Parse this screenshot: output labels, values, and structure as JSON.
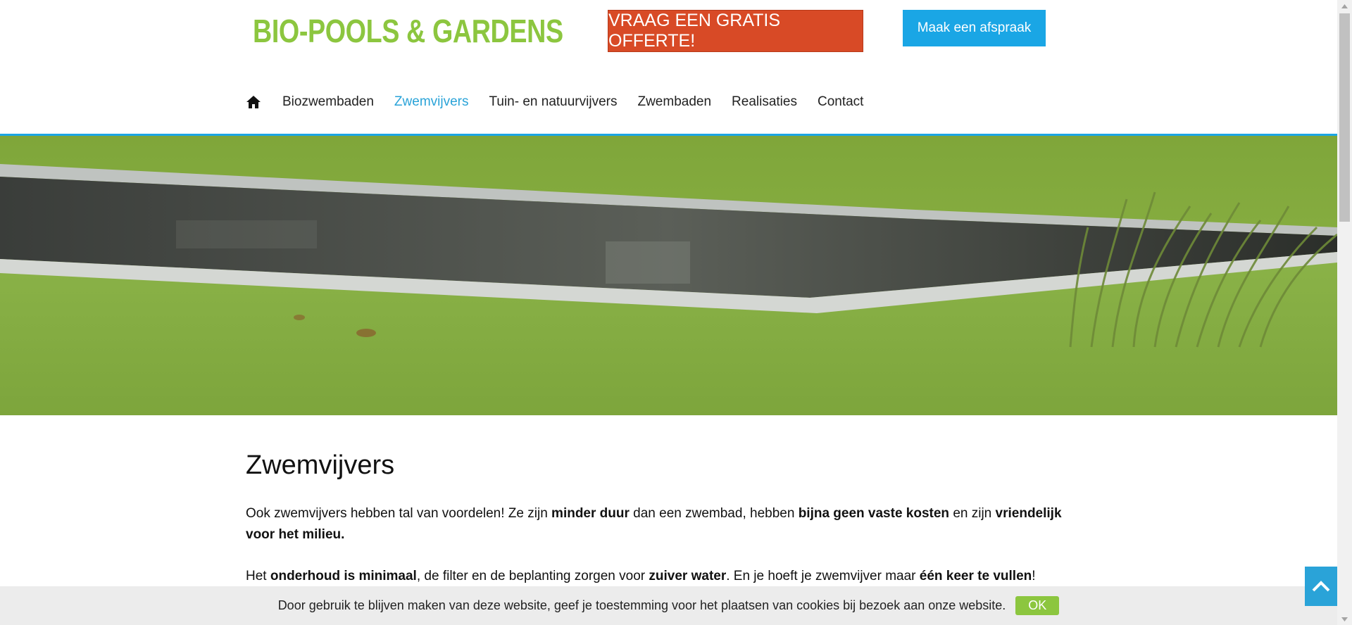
{
  "header": {
    "logo_text": "BIO-POOLS & GARDENS",
    "offer_button": "VRAAG EEN GRATIS OFFERTE!",
    "appointment_button": "Maak een afspraak"
  },
  "nav": {
    "home_icon": "home-icon",
    "items": [
      "Biozwembaden",
      "Zwemvijvers",
      "Tuin- en natuurvijvers",
      "Zwembaden",
      "Realisaties",
      "Contact"
    ],
    "active": "Zwemvijvers"
  },
  "content": {
    "title": "Zwemvijvers",
    "p1": {
      "t1": "Ook zwemvijvers hebben tal van voordelen! Ze zijn ",
      "b1": "minder duur",
      "t2": " dan een zwembad, hebben ",
      "b2": "bijna geen vaste kosten",
      "t3": " en zijn ",
      "b3": "vriendelijk voor het milieu."
    },
    "p2": {
      "t1": "Het ",
      "b1": "onderhoud is minimaal",
      "t2": ", de filter en de beplanting zorgen voor ",
      "b2": "zuiver water",
      "t3": ". En je hoeft je zwemvijver maar ",
      "b3": "één keer te vullen",
      "t4": "!"
    }
  },
  "cookie": {
    "text": "Door gebruik te blijven maken van deze website, geef je toestemming voor het plaatsen van cookies bij bezoek aan onze website.",
    "ok": "OK"
  },
  "colors": {
    "brand_green": "#8cc63f",
    "offer_red": "#d84a26",
    "accent_blue": "#1aa6e5"
  }
}
